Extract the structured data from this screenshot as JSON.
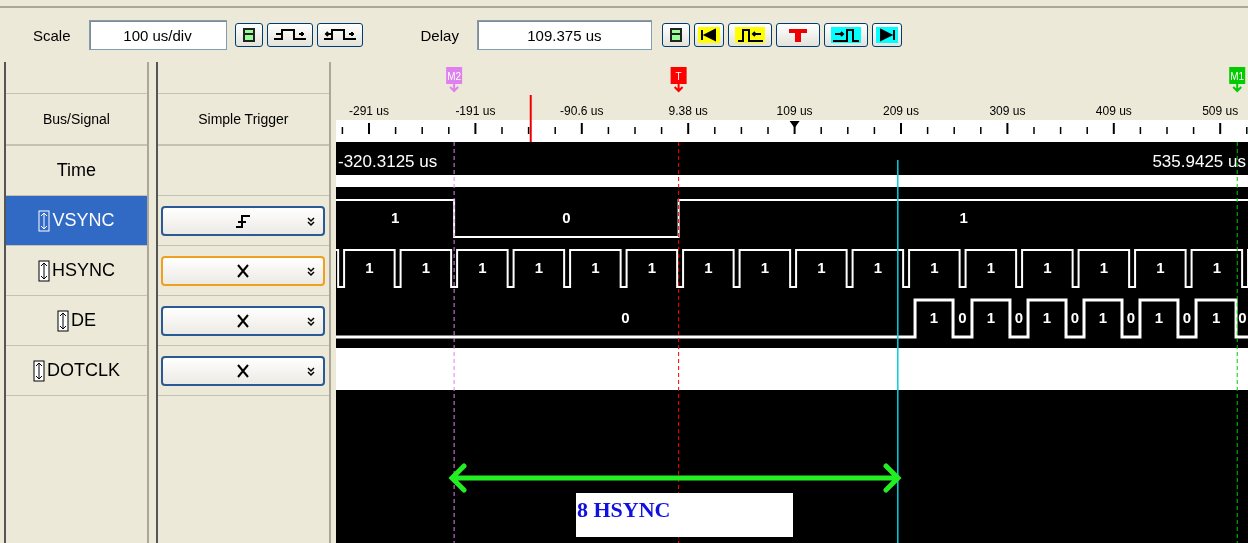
{
  "toolbar": {
    "scale_label": "Scale",
    "scale_value": "100 us/div",
    "delay_label": "Delay",
    "delay_value": "109.375 us"
  },
  "columns": {
    "signal": "Bus/Signal",
    "trigger": "Simple Trigger"
  },
  "time_row": {
    "label": "Time",
    "start": "-320.3125 us",
    "end": "535.9425 us"
  },
  "signals": [
    {
      "name": "VSYNC",
      "selected": true,
      "trigger": {
        "kind": "rising",
        "focused": false
      },
      "kind": "wave",
      "values": [
        "1",
        "0",
        "1"
      ]
    },
    {
      "name": "HSYNC",
      "selected": false,
      "trigger": {
        "kind": "dont_care",
        "focused": true
      },
      "kind": "wave",
      "values": [
        "1",
        "1",
        "1",
        "1",
        "1",
        "1",
        "1",
        "1",
        "1",
        "1",
        "1",
        "1",
        "1",
        "1",
        "1",
        "1"
      ]
    },
    {
      "name": "DE",
      "selected": false,
      "trigger": {
        "kind": "dont_care",
        "focused": false
      },
      "kind": "wave",
      "values": [
        "0",
        "1",
        "0",
        "1",
        "0",
        "1",
        "0",
        "1",
        "0",
        "1",
        "0",
        "1",
        "0"
      ]
    },
    {
      "name": "DOTCLK",
      "selected": false,
      "trigger": {
        "kind": "dont_care",
        "focused": false
      },
      "kind": "dense"
    }
  ],
  "markers": [
    {
      "label": "M2",
      "color": "#e080f0"
    },
    {
      "label": "T",
      "color": "#ff0000"
    },
    {
      "label": "M1",
      "color": "#00cc00"
    }
  ],
  "ticks": [
    "-291 us",
    "-191 us",
    "-90.6 us",
    "9.38 us",
    "109 us",
    "209 us",
    "309 us",
    "409 us",
    "509 us"
  ],
  "annotation": "8 HSYNC"
}
